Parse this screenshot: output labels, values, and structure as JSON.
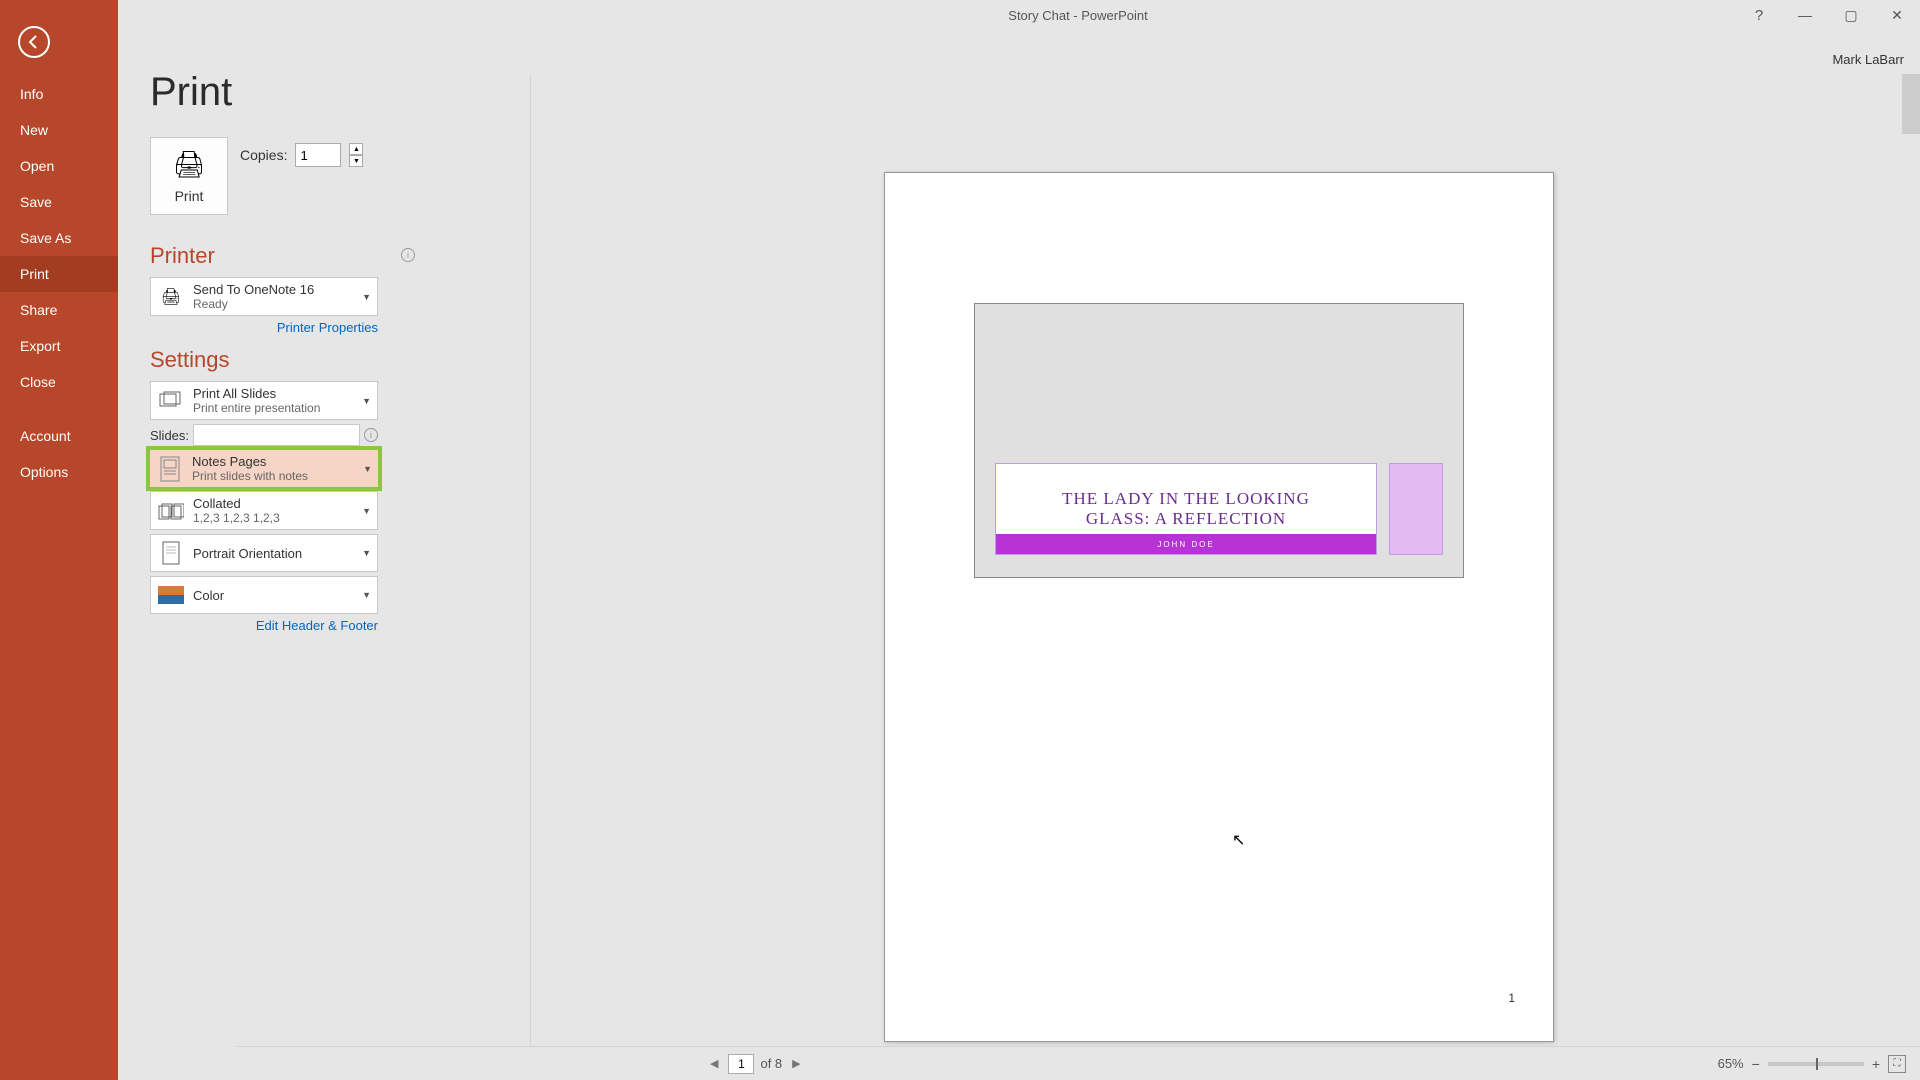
{
  "window": {
    "title": "Story Chat - PowerPoint",
    "user": "Mark LaBarr"
  },
  "sidebar": {
    "items": [
      {
        "label": "Info"
      },
      {
        "label": "New"
      },
      {
        "label": "Open"
      },
      {
        "label": "Save"
      },
      {
        "label": "Save As"
      },
      {
        "label": "Print"
      },
      {
        "label": "Share"
      },
      {
        "label": "Export"
      },
      {
        "label": "Close"
      }
    ],
    "bottom": [
      {
        "label": "Account"
      },
      {
        "label": "Options"
      }
    ]
  },
  "print": {
    "title": "Print",
    "print_button": "Print",
    "copies_label": "Copies:",
    "copies_value": "1",
    "printer_heading": "Printer",
    "printer": {
      "name": "Send To OneNote 16",
      "status": "Ready"
    },
    "printer_properties": "Printer Properties",
    "settings_heading": "Settings",
    "range": {
      "title": "Print All Slides",
      "sub": "Print entire presentation"
    },
    "slides_label": "Slides:",
    "slides_value": "",
    "layout": {
      "title": "Notes Pages",
      "sub": "Print slides with notes"
    },
    "collate": {
      "title": "Collated",
      "sub": "1,2,3    1,2,3    1,2,3"
    },
    "orientation": {
      "title": "Portrait Orientation"
    },
    "color": {
      "title": "Color"
    },
    "edit_hf": "Edit Header & Footer"
  },
  "preview": {
    "slide_title_l1": "THE LADY IN THE LOOKING",
    "slide_title_l2": "GLASS: A REFLECTION",
    "author": "JOHN DOE",
    "page_number": "1"
  },
  "status": {
    "current_page": "1",
    "page_of": "of 8",
    "zoom": "65%"
  }
}
